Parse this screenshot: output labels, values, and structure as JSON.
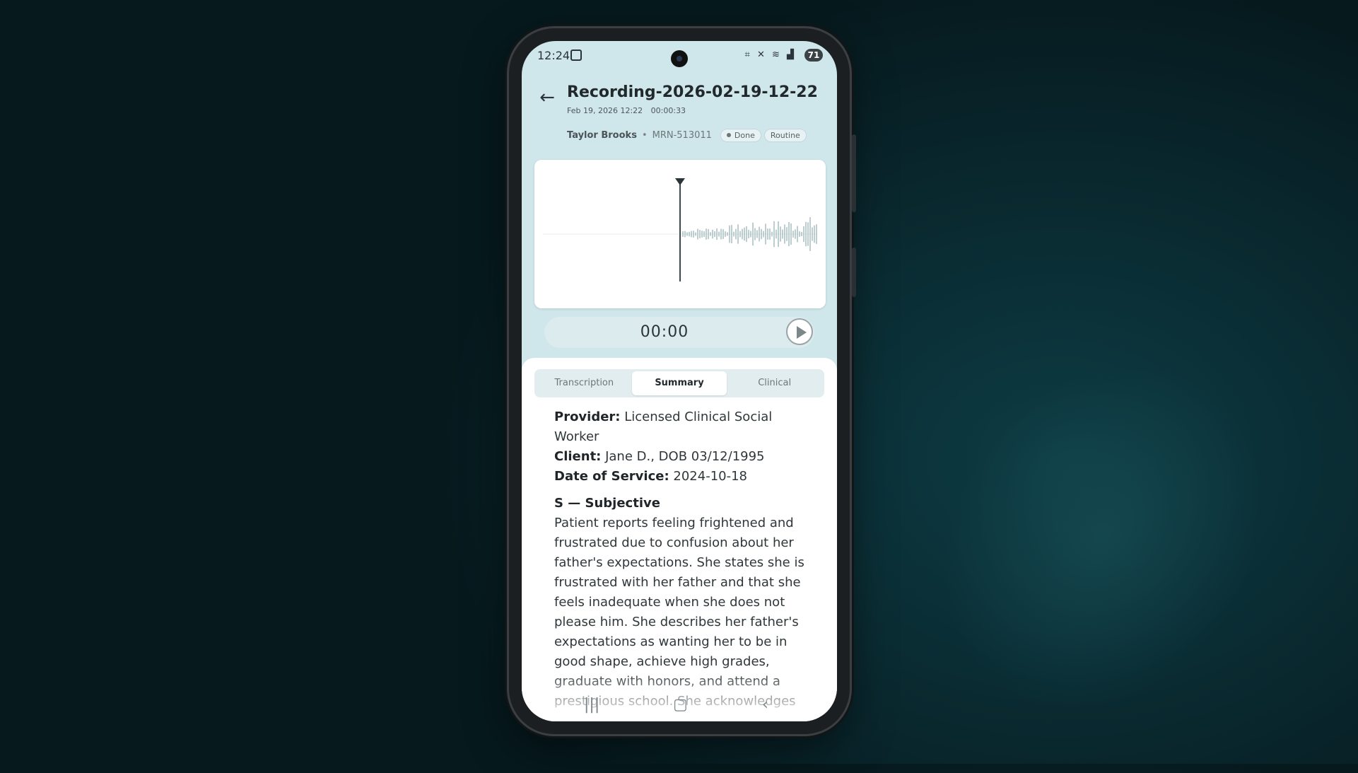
{
  "status": {
    "time": "12:24",
    "battery": "71",
    "icons": "⌗ ✕ ≋ ▟"
  },
  "header": {
    "title": "Recording-2026-02-19-12-22",
    "date": "Feb 19, 2026 12:22",
    "duration": "00:00:33",
    "patient": "Taylor Brooks",
    "separator": "•",
    "mrn": "MRN-513011",
    "status_badge": "Done",
    "priority_badge": "Routine"
  },
  "player": {
    "current_time": "00:00",
    "progress": 0
  },
  "tabs": [
    {
      "label": "Transcription",
      "active": false
    },
    {
      "label": "Summary",
      "active": true
    },
    {
      "label": "Clinical",
      "active": false
    }
  ],
  "summary": {
    "provider_label": "Provider:",
    "provider_value": " Licensed Clinical Social Worker",
    "client_label": "Client:",
    "client_value": " Jane D., DOB 03/12/1995",
    "dos_label": "Date of Service:",
    "dos_value": " 2024-10-18",
    "section_s": "S — Subjective",
    "subjective": "Patient reports feeling frightened and frustrated due to confusion about her father's expectations. She states she is frustrated with her father and that she feels inadequate when she does not please him. She describes her father's expectations as wanting her to be in good shape, achieve high grades, graduate with honors, and attend a prestigious school. She acknowledges"
  },
  "colors": {
    "accent": "#cfe6ea",
    "waveform": "#9fb8bc",
    "playhead": "#3c4a4e"
  }
}
